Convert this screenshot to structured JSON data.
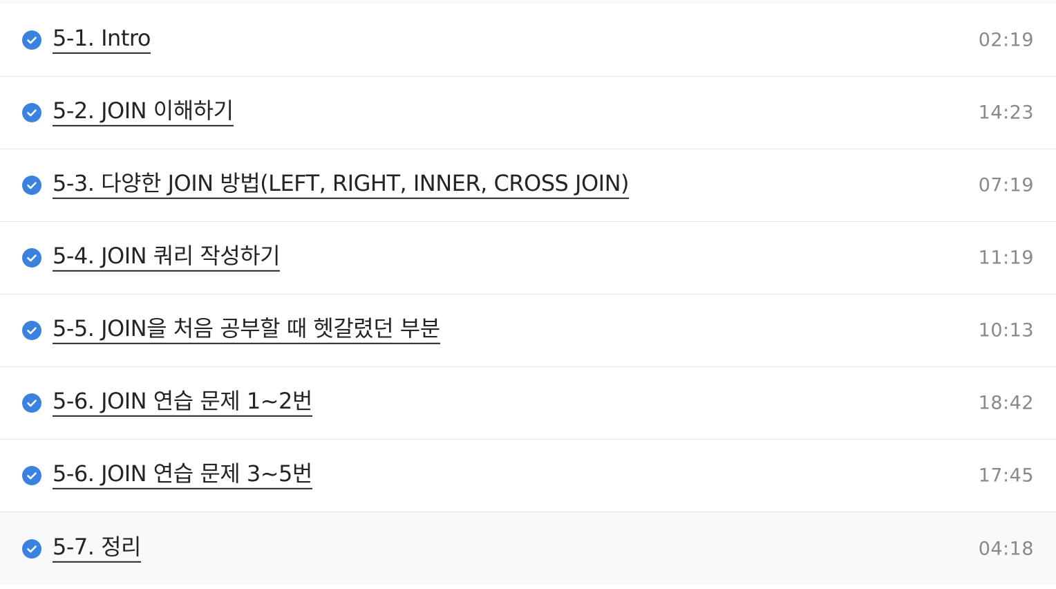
{
  "accent_color": "#3b82e0",
  "check_icon": "check-circle-icon",
  "lessons": [
    {
      "title": "5-1. Intro",
      "duration": "02:19",
      "completed": true
    },
    {
      "title": "5-2. JOIN 이해하기",
      "duration": "14:23",
      "completed": true
    },
    {
      "title": "5-3. 다양한 JOIN 방법(LEFT, RIGHT, INNER, CROSS JOIN)",
      "duration": "07:19",
      "completed": true
    },
    {
      "title": "5-4. JOIN 쿼리 작성하기",
      "duration": "11:19",
      "completed": true
    },
    {
      "title": "5-5. JOIN을 처음 공부할 때 헷갈렸던 부분",
      "duration": "10:13",
      "completed": true
    },
    {
      "title": "5-6. JOIN 연습 문제 1~2번",
      "duration": "18:42",
      "completed": true
    },
    {
      "title": "5-6. JOIN 연습 문제 3~5번",
      "duration": "17:45",
      "completed": true
    },
    {
      "title": "5-7. 정리",
      "duration": "04:18",
      "completed": true
    }
  ]
}
